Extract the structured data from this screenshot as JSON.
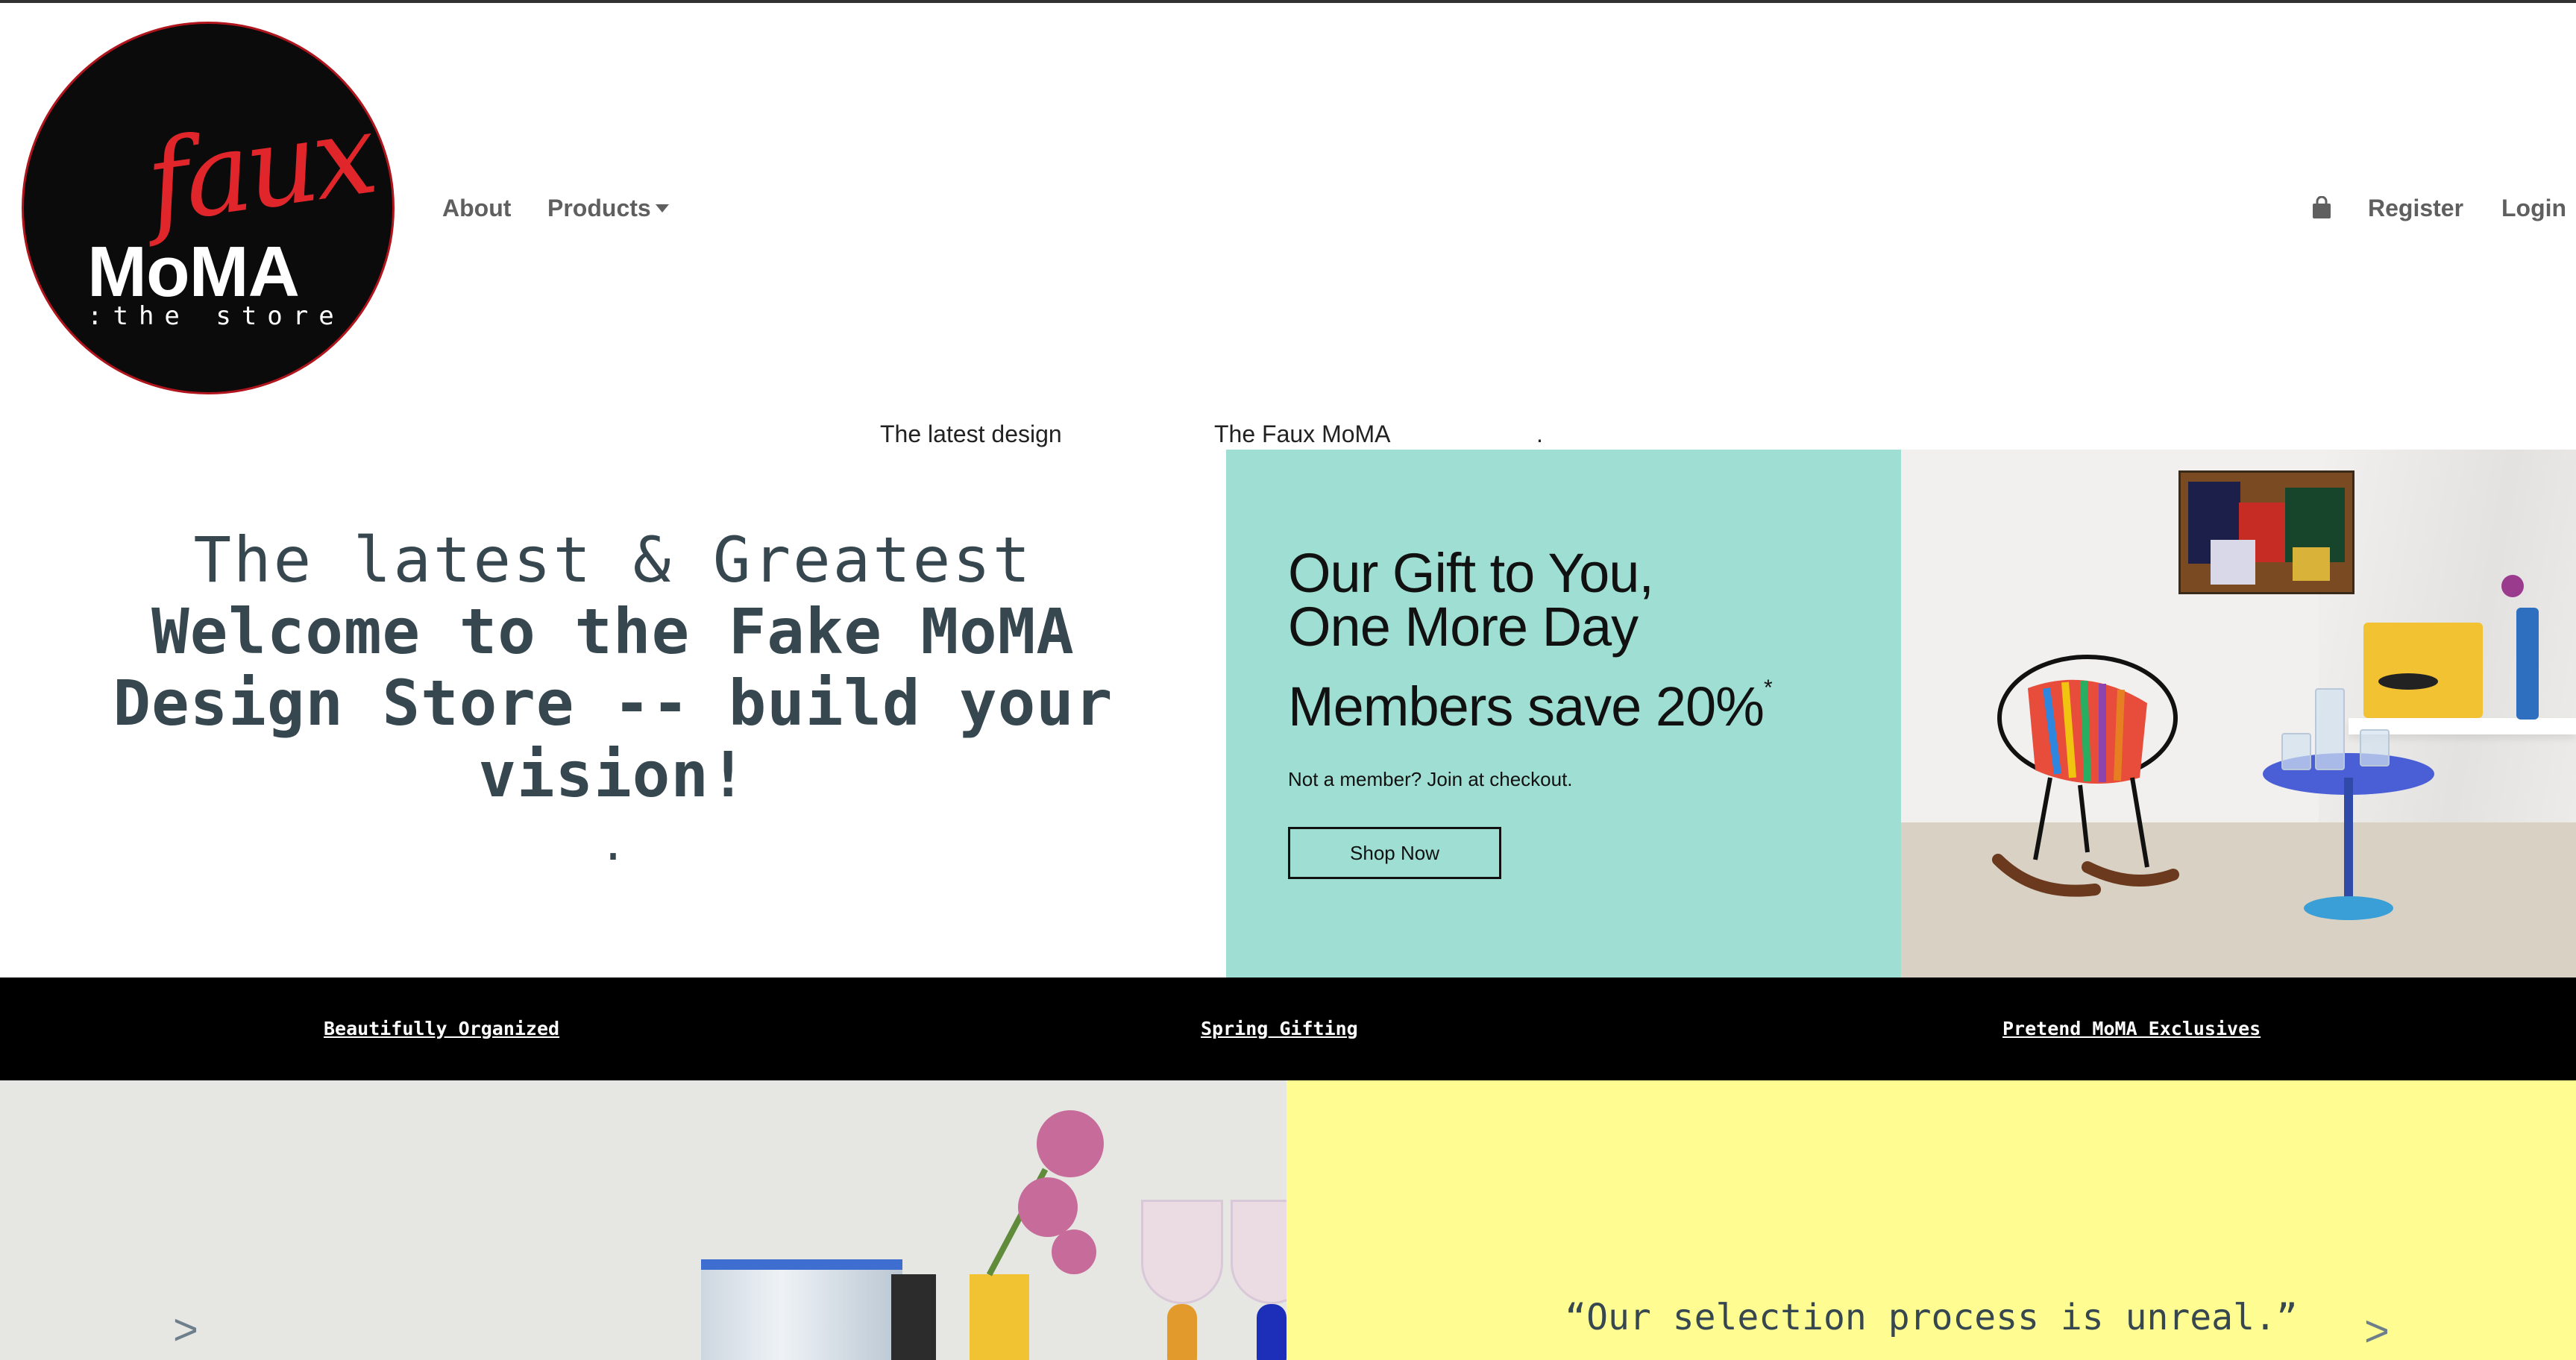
{
  "nav": {
    "logo": {
      "script": "faux",
      "name": "MoMA",
      "tagline": ":the store"
    },
    "about": "About",
    "products": "Products",
    "bag_icon": "shopping-bag-icon",
    "register": "Register",
    "login": "Login"
  },
  "subline": [
    "The latest design",
    "The Faux MoMA",
    "."
  ],
  "hero": {
    "small": "The latest & Greatest",
    "big": "Welcome to the Fake MoMA Design Store -- build your vision!",
    "dot": "."
  },
  "promo": {
    "title_line1": "Our Gift to You,",
    "title_line2": "One More Day",
    "save": "Members save 20%",
    "asterisk": "*",
    "note": "Not a member? Join at checkout.",
    "button": "Shop Now",
    "background": "#9fdfd3"
  },
  "category_bar": [
    "Beautifully Organized",
    "Spring Gifting",
    "Pretend MoMA Exclusives"
  ],
  "slider": {
    "quote": "“Our selection process is unreal.”",
    "prev": ">",
    "next": ">",
    "quote_background": "#fffd91"
  },
  "colors": {
    "accent_red": "#e0262a",
    "text_slate": "#37474f",
    "nav_gray": "#5f5f5f"
  }
}
